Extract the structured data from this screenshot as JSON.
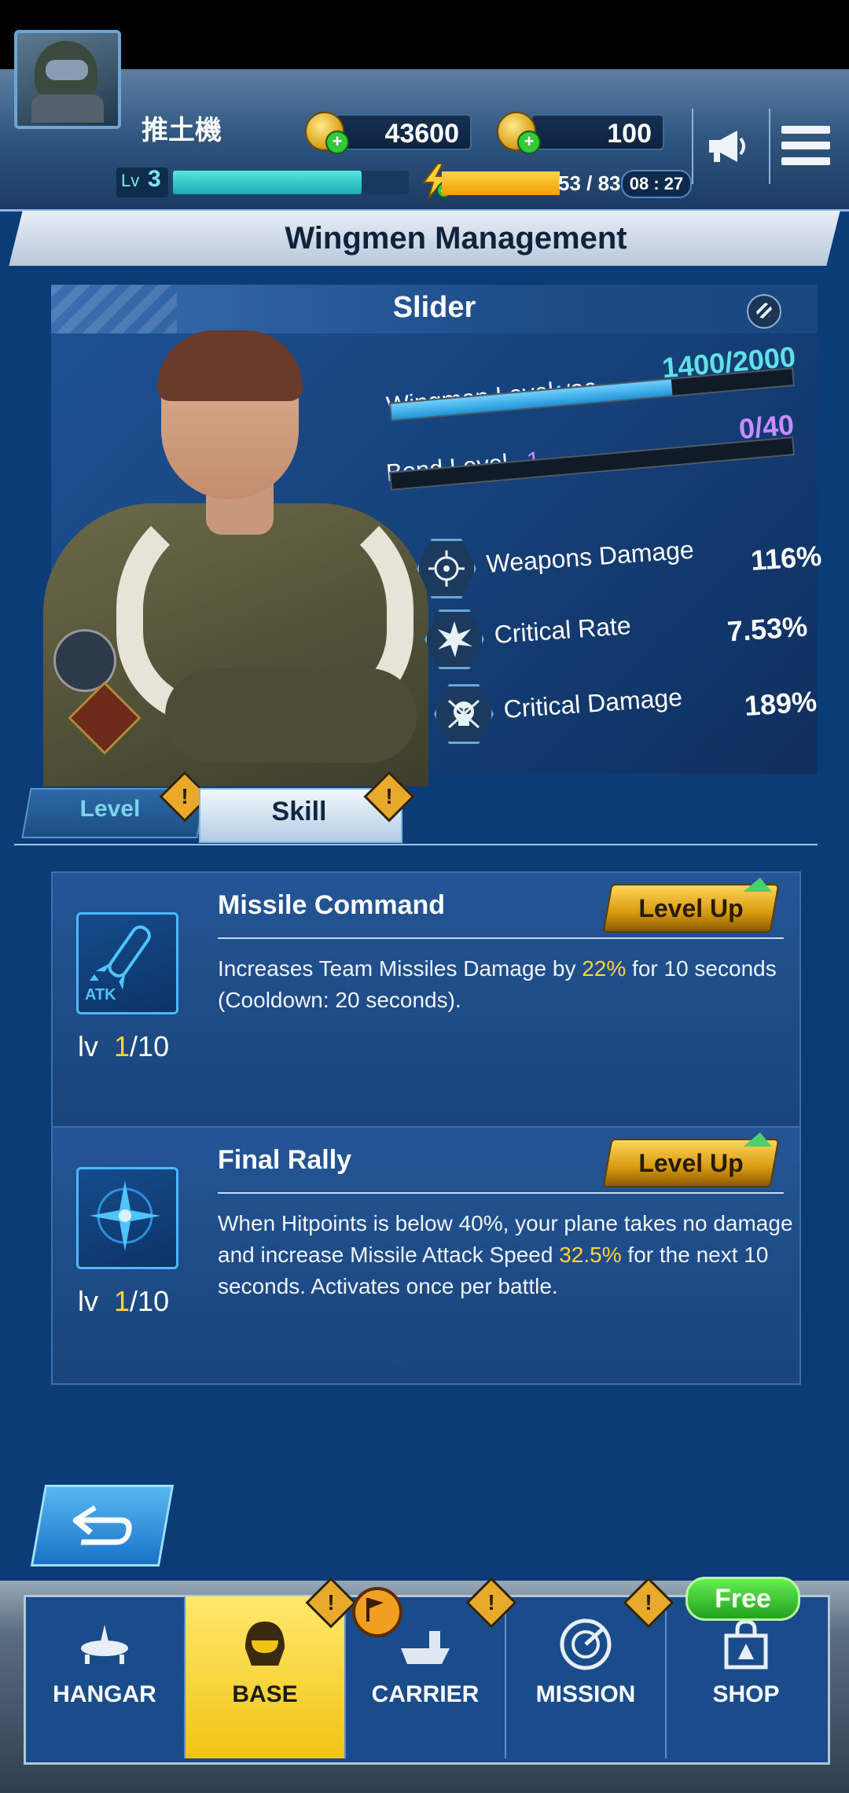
{
  "header": {
    "player_name": "推土機",
    "gold": "43600",
    "tokens": "100",
    "level_label": "Lv",
    "level_value": "3",
    "energy": "53 / 83",
    "timer": "08 : 27"
  },
  "page": {
    "title": "Wingmen Management"
  },
  "wingman": {
    "name": "Slider",
    "wingman_level_label": "Wingman Level",
    "wingman_level_value": "4",
    "wingman_level_max": "/30",
    "wingman_level_progress": "1400/2000",
    "wingman_level_fill": 0.7,
    "bond_level_label": "Bond Level",
    "bond_level_value": "1",
    "bond_level_progress": "0/40",
    "bond_level_fill": 0.0,
    "stats": [
      {
        "label": "Weapons Damage",
        "value": "116%",
        "icon": "crosshair-icon"
      },
      {
        "label": "Critical Rate",
        "value": "7.53%",
        "icon": "burst-icon"
      },
      {
        "label": "Critical Damage",
        "value": "189%",
        "icon": "skull-icon"
      }
    ]
  },
  "tabs": {
    "level": "Level",
    "skill": "Skill",
    "active": "Skill"
  },
  "skills": [
    {
      "title": "Missile Command",
      "button": "Level Up",
      "icon": "missile-icon",
      "icon_tag": "ATK",
      "level_prefix": "lv",
      "level_current": "1",
      "level_max": "/10",
      "desc_before": "Increases Team Missiles Damage by ",
      "desc_highlight": "22%",
      "desc_after": " for 10 seconds (Cooldown: 20 seconds)."
    },
    {
      "title": "Final Rally",
      "button": "Level Up",
      "icon": "star-compass-icon",
      "level_prefix": "lv",
      "level_current": "1",
      "level_max": "/10",
      "desc_before": "When Hitpoints is below 40%, your plane takes no damage and increase Missile Attack Speed ",
      "desc_highlight": "32.5%",
      "desc_after": " for the next 10 seconds. Activates once per battle."
    }
  ],
  "nav": {
    "items": [
      "HANGAR",
      "BASE",
      "CARRIER",
      "MISSION",
      "SHOP"
    ],
    "active": "BASE",
    "free_badge": "Free"
  },
  "alert_glyph": "!",
  "colors": {
    "accent_cyan": "#62e0e6",
    "bond_purple": "#c78cff",
    "highlight_yellow": "#ffd438",
    "nav_active": "#f0c414"
  }
}
